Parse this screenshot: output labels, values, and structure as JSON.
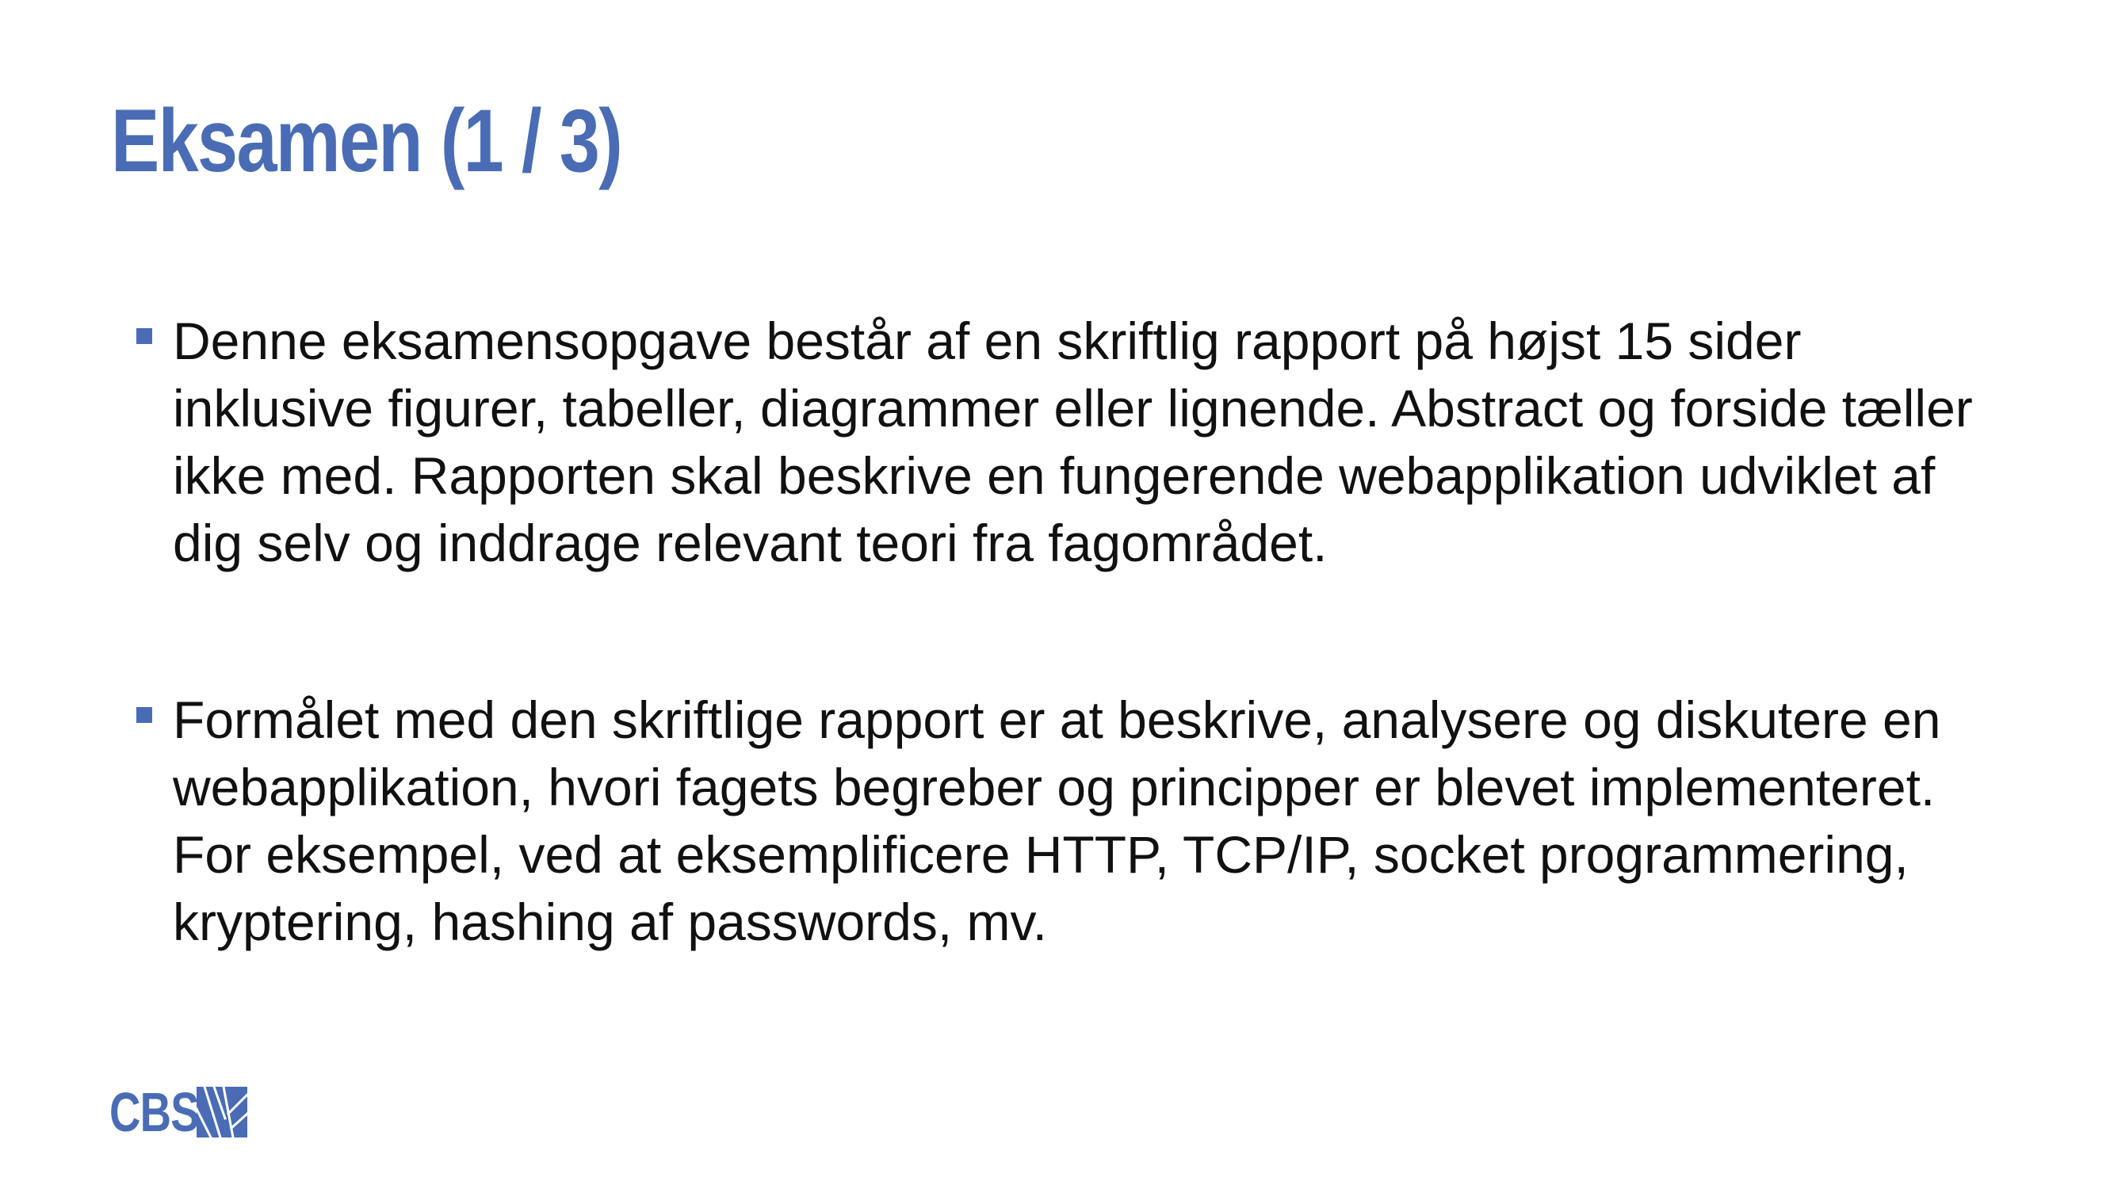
{
  "slide": {
    "title": "Eksamen (1 / 3)",
    "bullets": [
      {
        "text": "Denne eksamensopgave består af en skriftlig rapport på højst 15 sider inklusive figurer, tabeller, diagrammer eller lignende. Abstract og forside tæller ikke med. Rapporten skal beskrive en fungerende webapplikation udviklet af dig selv og inddrage relevant teori fra fagområdet."
      },
      {
        "text": "Formålet med den skriftlige rapport er at beskrive, analysere og diskutere en webapplikation, hvori fagets begreber og principper er blevet implementeret. For eksempel, ved at eksemplificere HTTP, TCP/IP, socket programmering, kryptering, hashing af passwords, mv."
      }
    ],
    "logo": {
      "text": "CBS",
      "icon": "cbs-logo-mark-icon"
    }
  },
  "colors": {
    "accent": "#4a6cb4",
    "text": "#111111",
    "background": "#ffffff"
  }
}
